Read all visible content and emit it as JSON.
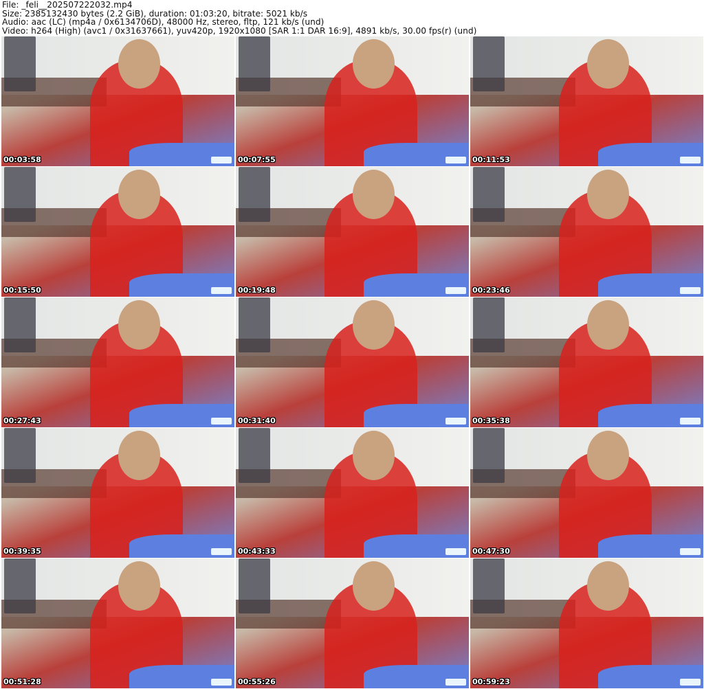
{
  "header": {
    "lines": [
      "File: _feli__202507222032.mp4",
      "Size: 2385132430 bytes (2.2 GiB), duration: 01:03:20, bitrate: 5021 kb/s",
      "Audio: aac (LC) (mp4a / 0x6134706D), 48000 Hz, stereo, fltp, 121 kb/s (und)",
      "Video: h264 (High) (avc1 / 0x31637661), yuv420p, 1920x1080 [SAR 1:1 DAR 16:9], 4891 kb/s, 30.00 fps(r) (und)"
    ]
  },
  "thumbnails": [
    {
      "timestamp": "00:03:58"
    },
    {
      "timestamp": "00:07:55"
    },
    {
      "timestamp": "00:11:53"
    },
    {
      "timestamp": "00:15:50"
    },
    {
      "timestamp": "00:19:48"
    },
    {
      "timestamp": "00:23:46"
    },
    {
      "timestamp": "00:27:43"
    },
    {
      "timestamp": "00:31:40"
    },
    {
      "timestamp": "00:35:38"
    },
    {
      "timestamp": "00:39:35"
    },
    {
      "timestamp": "00:43:33"
    },
    {
      "timestamp": "00:47:30"
    },
    {
      "timestamp": "00:51:28"
    },
    {
      "timestamp": "00:55:26"
    },
    {
      "timestamp": "00:59:23"
    }
  ]
}
